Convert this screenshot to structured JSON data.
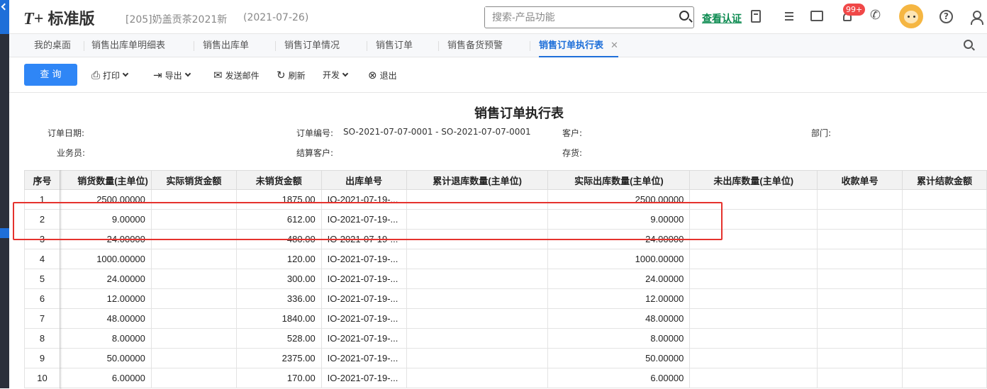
{
  "app": {
    "logo_mark": "T+",
    "logo_text": "标准版",
    "company": "[205]奶盖贡茶2021新",
    "date": "(2021-07-26)"
  },
  "search": {
    "placeholder": "搜索-产品功能"
  },
  "header": {
    "verify_label": "查看认证",
    "notifications_badge": "99+"
  },
  "tabs": [
    {
      "label": "我的桌面"
    },
    {
      "label": "销售出库单明细表"
    },
    {
      "label": "销售出库单"
    },
    {
      "label": "销售订单情况"
    },
    {
      "label": "销售订单"
    },
    {
      "label": "销售备货预警"
    },
    {
      "label": "销售订单执行表",
      "active": true
    }
  ],
  "toolbar": {
    "query": "查 询",
    "print": "打印",
    "export": "导出",
    "email": "发送邮件",
    "refresh": "刷新",
    "develop": "开发",
    "exit": "退出"
  },
  "report": {
    "title": "销售订单执行表",
    "filters": {
      "order_date_label": "订单日期:",
      "order_no_label": "订单编号:",
      "order_no_value": "SO-2021-07-07-0001 - SO-2021-07-07-0001",
      "customer_label": "客户:",
      "dept_label": "部门:",
      "salesman_label": "业务员:",
      "settle_customer_label": "结算客户:",
      "inventory_label": "存货:"
    },
    "columns": [
      "序号",
      "销货数量(主单位)",
      "实际销货金额",
      "未销货金额",
      "出库单号",
      "累计退库数量(主单位)",
      "实际出库数量(主单位)",
      "未出库数量(主单位)",
      "收款单号",
      "累计结款金额"
    ],
    "rows": [
      {
        "seq": "1",
        "sales_qty": "2500.00000",
        "actual_amount": "",
        "unsold_amount": "1875.00",
        "out_no": "IO-2021-07-19-...",
        "returned_qty": "",
        "actual_out_qty": "2500.00000",
        "unshipped_qty": "",
        "receipt_no": "",
        "settled_amount": ""
      },
      {
        "seq": "2",
        "sales_qty": "9.00000",
        "actual_amount": "",
        "unsold_amount": "612.00",
        "out_no": "IO-2021-07-19-...",
        "returned_qty": "",
        "actual_out_qty": "9.00000",
        "unshipped_qty": "",
        "receipt_no": "",
        "settled_amount": ""
      },
      {
        "seq": "3",
        "sales_qty": "24.00000",
        "actual_amount": "",
        "unsold_amount": "480.00",
        "out_no": "IO-2021-07-19-...",
        "returned_qty": "",
        "actual_out_qty": "24.00000",
        "unshipped_qty": "",
        "receipt_no": "",
        "settled_amount": ""
      },
      {
        "seq": "4",
        "sales_qty": "1000.00000",
        "actual_amount": "",
        "unsold_amount": "120.00",
        "out_no": "IO-2021-07-19-...",
        "returned_qty": "",
        "actual_out_qty": "1000.00000",
        "unshipped_qty": "",
        "receipt_no": "",
        "settled_amount": ""
      },
      {
        "seq": "5",
        "sales_qty": "24.00000",
        "actual_amount": "",
        "unsold_amount": "300.00",
        "out_no": "IO-2021-07-19-...",
        "returned_qty": "",
        "actual_out_qty": "24.00000",
        "unshipped_qty": "",
        "receipt_no": "",
        "settled_amount": ""
      },
      {
        "seq": "6",
        "sales_qty": "12.00000",
        "actual_amount": "",
        "unsold_amount": "336.00",
        "out_no": "IO-2021-07-19-...",
        "returned_qty": "",
        "actual_out_qty": "12.00000",
        "unshipped_qty": "",
        "receipt_no": "",
        "settled_amount": ""
      },
      {
        "seq": "7",
        "sales_qty": "48.00000",
        "actual_amount": "",
        "unsold_amount": "1840.00",
        "out_no": "IO-2021-07-19-...",
        "returned_qty": "",
        "actual_out_qty": "48.00000",
        "unshipped_qty": "",
        "receipt_no": "",
        "settled_amount": ""
      },
      {
        "seq": "8",
        "sales_qty": "8.00000",
        "actual_amount": "",
        "unsold_amount": "528.00",
        "out_no": "IO-2021-07-19-...",
        "returned_qty": "",
        "actual_out_qty": "8.00000",
        "unshipped_qty": "",
        "receipt_no": "",
        "settled_amount": ""
      },
      {
        "seq": "9",
        "sales_qty": "50.00000",
        "actual_amount": "",
        "unsold_amount": "2375.00",
        "out_no": "IO-2021-07-19-...",
        "returned_qty": "",
        "actual_out_qty": "50.00000",
        "unshipped_qty": "",
        "receipt_no": "",
        "settled_amount": ""
      },
      {
        "seq": "10",
        "sales_qty": "6.00000",
        "actual_amount": "",
        "unsold_amount": "170.00",
        "out_no": "IO-2021-07-19-...",
        "returned_qty": "",
        "actual_out_qty": "6.00000",
        "unshipped_qty": "",
        "receipt_no": "",
        "settled_amount": ""
      }
    ]
  },
  "colors": {
    "accent": "#2f86f6",
    "link": "#2f6fd9",
    "verify": "#0a8a4f",
    "highlight": "#e5322d",
    "badge": "#f04848"
  }
}
